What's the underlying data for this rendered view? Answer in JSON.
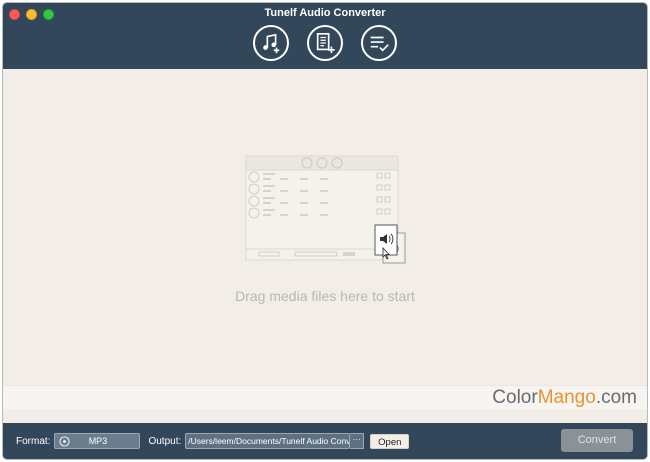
{
  "window": {
    "title": "Tunelf Audio Converter"
  },
  "toolbar": {
    "buttons": [
      {
        "icon": "add-music-icon"
      },
      {
        "icon": "add-file-icon"
      },
      {
        "icon": "converted-list-icon"
      }
    ]
  },
  "dropzone": {
    "hint": "Drag media files here to start"
  },
  "watermark": {
    "text_main": "Color",
    "text_accent": "Mango",
    "text_suffix": ".com"
  },
  "bottombar": {
    "format_label": "Format:",
    "format_value": "MP3",
    "output_label": "Output:",
    "output_path": "/Users/leem/Documents/Tunelf Audio Convert",
    "browse_label": "···",
    "open_label": "Open",
    "convert_label": "Convert"
  },
  "colors": {
    "header_bg": "#33475a",
    "content_bg": "#f2eee7",
    "accent_watermark": "#e99232"
  }
}
